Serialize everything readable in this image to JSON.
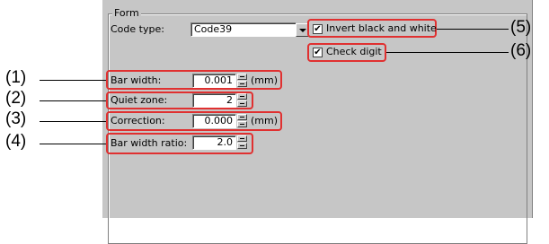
{
  "form": {
    "title": "Form",
    "code_type_label": "Code type:",
    "code_type_value": "Code39",
    "invert_label": "Invert black and white",
    "invert_checked": true,
    "check_digit_label": "Check digit",
    "check_digit_checked": true,
    "bar_width_label": "Bar width:",
    "bar_width_value": "0.001",
    "bar_width_unit": "(mm)",
    "quiet_zone_label": "Quiet zone:",
    "quiet_zone_value": "2",
    "correction_label": "Correction:",
    "correction_value": "0.000",
    "correction_unit": "(mm)",
    "bar_width_ratio_label": "Bar width ratio:",
    "bar_width_ratio_value": "2.0"
  },
  "callouts": {
    "c1": "(1)",
    "c2": "(2)",
    "c3": "(3)",
    "c4": "(4)",
    "c5": "(5)",
    "c6": "(6)"
  },
  "colors": {
    "highlight": "#e03030",
    "panel": "#c6c6c6"
  },
  "icons": {
    "checkmark": "✔"
  }
}
